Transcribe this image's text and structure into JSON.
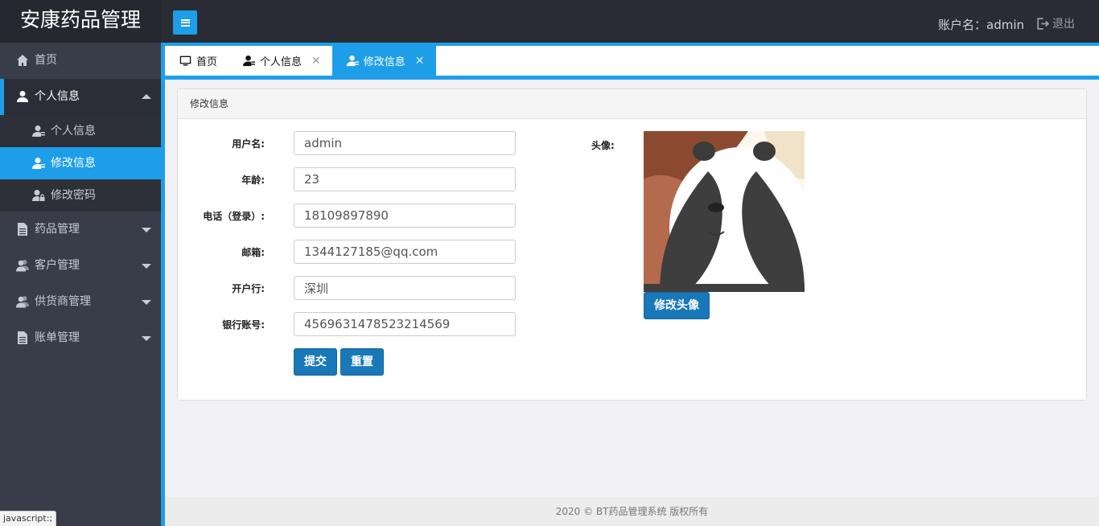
{
  "header": {
    "brand": "安康药品管理",
    "account": "账户名：admin",
    "logout_label": "退出"
  },
  "sidebar": {
    "items": [
      {
        "label": "首页",
        "icon": "home-icon"
      },
      {
        "label": "个人信息",
        "icon": "user-icon",
        "expanded": true,
        "children": [
          {
            "label": "个人信息",
            "icon": "user-card-icon"
          },
          {
            "label": "修改信息",
            "icon": "user-edit-icon",
            "active": true
          },
          {
            "label": "修改密码",
            "icon": "user-lock-icon"
          }
        ]
      },
      {
        "label": "药品管理",
        "icon": "document-icon"
      },
      {
        "label": "客户管理",
        "icon": "users-icon"
      },
      {
        "label": "供货商管理",
        "icon": "users-icon"
      },
      {
        "label": "账单管理",
        "icon": "document-icon"
      }
    ]
  },
  "tabs": [
    {
      "label": "首页",
      "icon": "monitor-icon",
      "closable": false
    },
    {
      "label": "个人信息",
      "icon": "user-card-icon",
      "closable": true
    },
    {
      "label": "修改信息",
      "icon": "user-edit-icon",
      "closable": true,
      "active": true
    }
  ],
  "panel": {
    "title": "修改信息",
    "fields": [
      {
        "label": "用户名:",
        "value": "admin"
      },
      {
        "label": "年龄:",
        "value": "23"
      },
      {
        "label": "电话（登录）:",
        "value": "18109897890"
      },
      {
        "label": "邮箱:",
        "value": "1344127185@qq.com"
      },
      {
        "label": "开户行:",
        "value": "深圳"
      },
      {
        "label": "银行账号:",
        "value": "4569631478523214569"
      }
    ],
    "submit_label": "提交",
    "reset_label": "重置",
    "avatar_label": "头像:",
    "change_avatar_label": "修改头像"
  },
  "footer": {
    "text": "2020 © BT药品管理系统 版权所有"
  },
  "status_tip": "javascript:;",
  "colors": {
    "accent": "#1e9ee8",
    "sidebar": "#393d49",
    "header": "#292c34",
    "button": "#1878b8"
  }
}
